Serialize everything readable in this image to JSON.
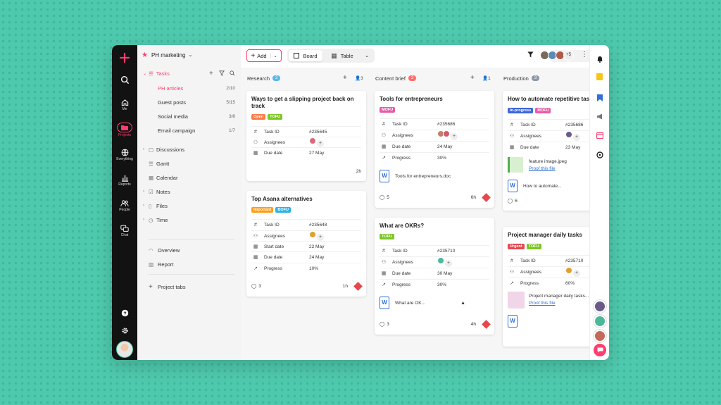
{
  "rail": {
    "items": [
      {
        "label": "Me"
      },
      {
        "label": "Projects"
      },
      {
        "label": "Everything"
      },
      {
        "label": "Reports"
      },
      {
        "label": "People"
      },
      {
        "label": "Chat"
      }
    ]
  },
  "sidebar": {
    "project": "PH marketing",
    "tasks_label": "Tasks",
    "task_lists": [
      {
        "label": "PH articles",
        "count": "2/10"
      },
      {
        "label": "Guest posts",
        "count": "5/15"
      },
      {
        "label": "Social media",
        "count": "3/8"
      },
      {
        "label": "Email campaign",
        "count": "1/7"
      }
    ],
    "sections": [
      {
        "label": "Discussions"
      },
      {
        "label": "Gantt"
      },
      {
        "label": "Calendar"
      },
      {
        "label": "Notes"
      },
      {
        "label": "Files"
      },
      {
        "label": "Time"
      }
    ],
    "extras": [
      {
        "label": "Overview"
      },
      {
        "label": "Report"
      }
    ],
    "project_tabs": "Project tabs"
  },
  "toolbar": {
    "add": "Add",
    "board": "Board",
    "table": "Table",
    "search_placeholder": "Search",
    "member_count": "+5"
  },
  "columns": [
    {
      "name": "Research",
      "count": "2",
      "people": "3"
    },
    {
      "name": "Content brief",
      "count": "2",
      "people": "1"
    },
    {
      "name": "Production",
      "count": "3"
    }
  ],
  "fields": {
    "task_id": "Task ID",
    "assignees": "Assignees",
    "start_date": "Start date",
    "due_date": "Due date",
    "progress": "Progress"
  },
  "cards": {
    "c1": {
      "title": "Ways to get a slipping project back on track",
      "tags": [
        "Open",
        "TOFU"
      ],
      "task_id": "#235645",
      "due": "27 May",
      "time": "2h"
    },
    "c2": {
      "title": "Top Asana alternatives",
      "tags": [
        "Important",
        "BOFU"
      ],
      "task_id": "#235648",
      "start": "22 May",
      "due": "24 May",
      "progress": "10%",
      "comments": "3",
      "time": "1h"
    },
    "c3": {
      "title": "Tools for entrepreneurs",
      "tags": [
        "MOFU"
      ],
      "task_id": "#235686",
      "due": "24 May",
      "progress": "30%",
      "file": "Tools for entrepreneurs.doc",
      "comments": "5",
      "time": "6h"
    },
    "c4": {
      "title": "What are OKRs?",
      "tags": [
        "TOFU"
      ],
      "task_id": "#235710",
      "due": "30 May",
      "progress": "30%",
      "file": "What are OK...",
      "comments": "3",
      "time": "4h"
    },
    "c5": {
      "title": "How to automate repetitive tasks",
      "tags": [
        "In-progress",
        "MOFU"
      ],
      "task_id": "#235686",
      "due": "23 May",
      "file1": "feature image.jpeg",
      "proof": "Proof this file",
      "file2": "How to automate...",
      "comments": "6"
    },
    "c6": {
      "title": "Project manager daily tasks",
      "tags": [
        "Urgent",
        "TOFU"
      ],
      "task_id": "#235710",
      "progress": "60%",
      "file1": "Project manager daily tasks...",
      "proof": "Proof this file"
    }
  },
  "colors": {
    "accent": "#ff3d6e",
    "rail": "#121212",
    "open": "#ff7a45",
    "tofu": "#7cc624",
    "important": "#ff9c1a",
    "bofu": "#27b4e8",
    "mofu": "#e85aa8",
    "inprogress": "#3d66d9",
    "urgent": "#e5484d",
    "research_badge": "#5bb8e8",
    "brief_badge": "#ff6b6b",
    "production_badge": "#8d98a6"
  }
}
